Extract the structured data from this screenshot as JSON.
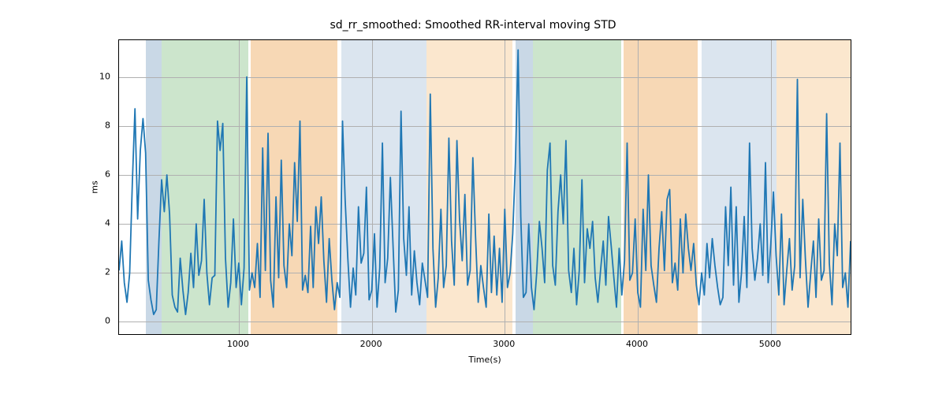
{
  "chart_data": {
    "type": "line",
    "title": "sd_rr_smoothed: Smoothed RR-interval moving STD",
    "xlabel": "Time(s)",
    "ylabel": "ms",
    "xlim": [
      100,
      5600
    ],
    "ylim": [
      -0.5,
      11.5
    ],
    "xticks": [
      1000,
      2000,
      3000,
      4000,
      5000
    ],
    "yticks": [
      0,
      2,
      4,
      6,
      8,
      10
    ],
    "line_color": "#1f77b4",
    "regions": [
      {
        "x0": 300,
        "x1": 420,
        "color": "#c9d8e6"
      },
      {
        "x0": 420,
        "x1": 1070,
        "color": "#cce5cc"
      },
      {
        "x0": 1090,
        "x1": 1740,
        "color": "#f7d8b5"
      },
      {
        "x0": 1770,
        "x1": 2410,
        "color": "#dbe5ef"
      },
      {
        "x0": 2410,
        "x1": 3060,
        "color": "#fbe7ce"
      },
      {
        "x0": 3080,
        "x1": 3210,
        "color": "#c9d8e6"
      },
      {
        "x0": 3210,
        "x1": 3875,
        "color": "#cce5cc"
      },
      {
        "x0": 3895,
        "x1": 4450,
        "color": "#f7d8b5"
      },
      {
        "x0": 4480,
        "x1": 5040,
        "color": "#dbe5ef"
      },
      {
        "x0": 5040,
        "x1": 5600,
        "color": "#fbe7ce"
      }
    ],
    "x": [
      100,
      120,
      140,
      160,
      180,
      200,
      220,
      240,
      260,
      280,
      300,
      320,
      340,
      360,
      380,
      400,
      420,
      440,
      460,
      480,
      500,
      520,
      540,
      560,
      580,
      600,
      620,
      640,
      660,
      680,
      700,
      720,
      740,
      760,
      780,
      800,
      820,
      840,
      860,
      880,
      900,
      920,
      940,
      960,
      980,
      1000,
      1020,
      1040,
      1060,
      1080,
      1100,
      1120,
      1140,
      1160,
      1180,
      1200,
      1220,
      1240,
      1260,
      1280,
      1300,
      1320,
      1340,
      1360,
      1380,
      1400,
      1420,
      1440,
      1460,
      1480,
      1500,
      1520,
      1540,
      1560,
      1580,
      1600,
      1620,
      1640,
      1660,
      1680,
      1700,
      1720,
      1740,
      1760,
      1780,
      1800,
      1820,
      1840,
      1860,
      1880,
      1900,
      1920,
      1940,
      1960,
      1980,
      2000,
      2020,
      2040,
      2060,
      2080,
      2100,
      2120,
      2140,
      2160,
      2180,
      2200,
      2220,
      2240,
      2260,
      2280,
      2300,
      2320,
      2340,
      2360,
      2380,
      2400,
      2420,
      2440,
      2460,
      2480,
      2500,
      2520,
      2540,
      2560,
      2580,
      2600,
      2620,
      2640,
      2660,
      2680,
      2700,
      2720,
      2740,
      2760,
      2780,
      2800,
      2820,
      2840,
      2860,
      2880,
      2900,
      2920,
      2940,
      2960,
      2980,
      3000,
      3020,
      3040,
      3060,
      3080,
      3100,
      3120,
      3140,
      3160,
      3180,
      3200,
      3220,
      3240,
      3260,
      3280,
      3300,
      3320,
      3340,
      3360,
      3380,
      3400,
      3420,
      3440,
      3460,
      3480,
      3500,
      3520,
      3540,
      3560,
      3580,
      3600,
      3620,
      3640,
      3660,
      3680,
      3700,
      3720,
      3740,
      3760,
      3780,
      3800,
      3820,
      3840,
      3860,
      3880,
      3900,
      3920,
      3940,
      3960,
      3980,
      4000,
      4020,
      4040,
      4060,
      4080,
      4100,
      4120,
      4140,
      4160,
      4180,
      4200,
      4220,
      4240,
      4260,
      4280,
      4300,
      4320,
      4340,
      4360,
      4380,
      4400,
      4420,
      4440,
      4460,
      4480,
      4500,
      4520,
      4540,
      4560,
      4580,
      4600,
      4620,
      4640,
      4660,
      4680,
      4700,
      4720,
      4740,
      4760,
      4780,
      4800,
      4820,
      4840,
      4860,
      4880,
      4900,
      4920,
      4940,
      4960,
      4980,
      5000,
      5020,
      5040,
      5060,
      5080,
      5100,
      5120,
      5140,
      5160,
      5180,
      5200,
      5220,
      5240,
      5260,
      5280,
      5300,
      5320,
      5340,
      5360,
      5380,
      5400,
      5420,
      5440,
      5460,
      5480,
      5500,
      5520,
      5540,
      5560,
      5580,
      5600
    ],
    "values": [
      2.1,
      3.3,
      1.6,
      0.8,
      2.0,
      5.7,
      8.7,
      4.2,
      7.0,
      8.3,
      6.9,
      1.7,
      0.9,
      0.3,
      0.5,
      3.3,
      5.8,
      4.5,
      6.0,
      4.4,
      1.1,
      0.6,
      0.4,
      2.6,
      1.3,
      0.3,
      1.2,
      2.8,
      1.4,
      4.0,
      1.9,
      2.5,
      5.0,
      2.0,
      0.7,
      1.8,
      1.9,
      8.2,
      7.0,
      8.1,
      2.6,
      0.6,
      1.6,
      4.2,
      1.4,
      2.4,
      0.7,
      2.2,
      10.0,
      1.3,
      2.0,
      1.4,
      3.2,
      1.0,
      7.1,
      2.1,
      7.7,
      1.7,
      0.6,
      5.1,
      1.8,
      6.6,
      2.3,
      1.4,
      4.0,
      2.7,
      6.5,
      4.1,
      8.2,
      1.3,
      1.9,
      1.2,
      3.9,
      1.4,
      4.7,
      3.2,
      5.1,
      2.5,
      0.8,
      3.4,
      1.7,
      0.5,
      1.6,
      1.0,
      8.2,
      5.0,
      2.6,
      0.6,
      2.2,
      1.1,
      4.7,
      2.4,
      2.8,
      5.5,
      0.9,
      1.3,
      3.6,
      0.6,
      2.2,
      7.3,
      1.6,
      2.6,
      5.9,
      3.1,
      0.4,
      1.3,
      8.6,
      3.4,
      1.9,
      4.7,
      1.1,
      2.9,
      1.6,
      0.7,
      2.4,
      1.7,
      1.0,
      9.3,
      3.0,
      0.6,
      1.8,
      4.6,
      1.4,
      2.3,
      7.5,
      3.3,
      1.5,
      7.4,
      4.2,
      2.5,
      5.2,
      1.5,
      2.1,
      6.7,
      3.5,
      0.8,
      2.3,
      1.4,
      0.6,
      4.4,
      1.2,
      3.5,
      1.1,
      3.0,
      0.8,
      4.6,
      1.4,
      2.0,
      3.6,
      6.5,
      11.1,
      4.3,
      1.0,
      1.2,
      4.0,
      1.4,
      0.5,
      2.0,
      4.1,
      3.0,
      1.6,
      6.2,
      7.3,
      2.3,
      1.5,
      4.5,
      6.0,
      4.0,
      7.4,
      2.1,
      1.2,
      3.0,
      0.7,
      2.1,
      5.8,
      1.6,
      3.8,
      3.0,
      4.1,
      1.8,
      0.8,
      2.1,
      3.3,
      1.5,
      4.3,
      3.1,
      1.8,
      0.6,
      3.0,
      1.1,
      2.5,
      7.3,
      1.7,
      2.0,
      4.2,
      1.2,
      0.6,
      4.6,
      2.1,
      6.0,
      2.3,
      1.5,
      0.8,
      3.0,
      4.5,
      2.1,
      5.0,
      5.4,
      1.6,
      2.4,
      1.3,
      4.2,
      2.0,
      4.4,
      3.0,
      2.1,
      3.2,
      1.5,
      0.7,
      2.0,
      1.1,
      3.2,
      1.8,
      3.4,
      2.3,
      1.4,
      0.7,
      1.0,
      4.7,
      2.3,
      5.5,
      1.5,
      4.7,
      0.8,
      2.0,
      4.3,
      1.4,
      7.3,
      3.0,
      1.7,
      2.6,
      4.0,
      1.9,
      6.5,
      1.6,
      3.2,
      5.3,
      2.7,
      1.1,
      4.4,
      0.7,
      2.1,
      3.4,
      1.3,
      2.3,
      9.9,
      1.8,
      5.0,
      2.6,
      0.6,
      2.0,
      3.3,
      1.0,
      4.2,
      1.7,
      2.1,
      8.5,
      2.4,
      0.7,
      4.0,
      2.7,
      7.3,
      1.4,
      2.0,
      0.6,
      3.3
    ]
  }
}
